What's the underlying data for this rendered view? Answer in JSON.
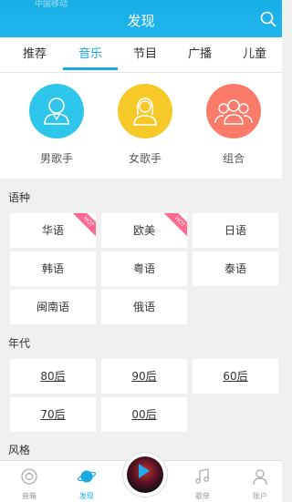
{
  "header": {
    "title": "发现",
    "status_text": "中国移动"
  },
  "tabs": [
    {
      "label": "推荐"
    },
    {
      "label": "音乐"
    },
    {
      "label": "节目"
    },
    {
      "label": "广播"
    },
    {
      "label": "儿童"
    }
  ],
  "active_tab": "音乐",
  "artists": [
    {
      "label": "男歌手",
      "color": "#2dc5e9"
    },
    {
      "label": "女歌手",
      "color": "#f6c928"
    },
    {
      "label": "组合",
      "color": "#fb7a6a"
    }
  ],
  "languages": {
    "title": "语种",
    "items": [
      "华语",
      "欧美",
      "日语",
      "韩语",
      "粤语",
      "泰语",
      "闽南语",
      "俄语"
    ],
    "hot_badge": "HOT"
  },
  "eras": {
    "title": "年代",
    "items": [
      "80后",
      "90后",
      "60后",
      "70后",
      "00后"
    ]
  },
  "styles": {
    "title": "风格"
  },
  "bottom_nav": [
    {
      "label": "音箱",
      "icon": "speaker-icon"
    },
    {
      "label": "发现",
      "icon": "planet-icon"
    },
    {
      "label": "歌单",
      "icon": "music-note-icon"
    },
    {
      "label": "账户",
      "icon": "user-icon"
    }
  ]
}
